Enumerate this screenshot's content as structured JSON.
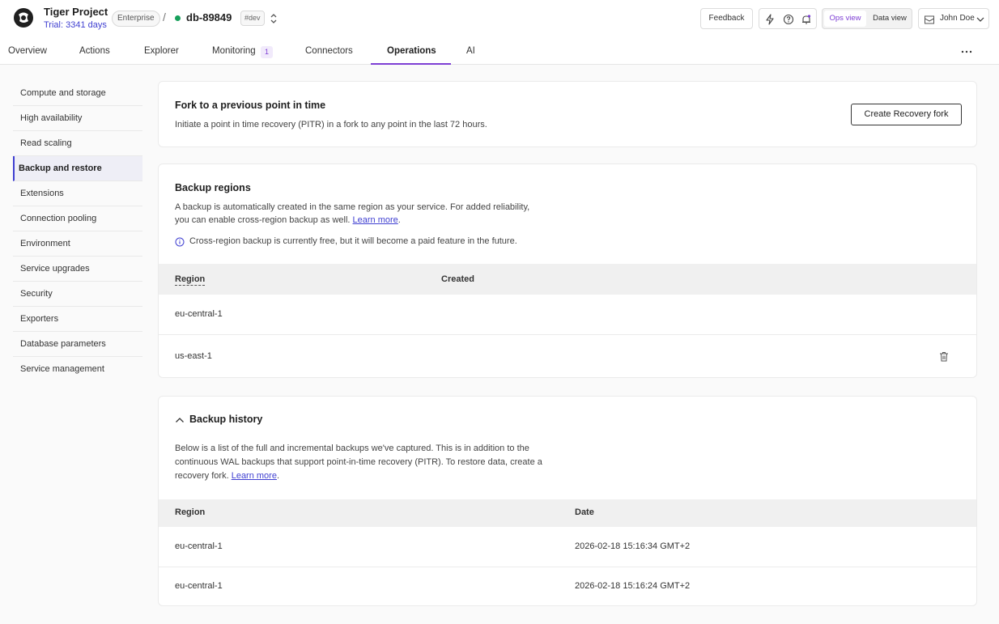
{
  "header": {
    "project_name": "Tiger Project",
    "trial": "Trial: 3341 days",
    "plan_badge": "Enterprise",
    "breadcrumb_sep": "/",
    "service_name": "db-89849",
    "env_badge": "#dev",
    "feedback_label": "Feedback",
    "ops_view_label": "Ops view",
    "data_view_label": "Data view",
    "user_name": "John Doe",
    "status_color": "#17a05b",
    "accent_color": "#7e3fd4",
    "link_color": "#3f3fd1"
  },
  "tabs": [
    {
      "label": "Overview"
    },
    {
      "label": "Actions"
    },
    {
      "label": "Explorer"
    },
    {
      "label": "Monitoring",
      "count": "1"
    },
    {
      "label": "Connectors"
    },
    {
      "label": "Operations",
      "active": true
    },
    {
      "label": "AI"
    }
  ],
  "sidebar": {
    "items": [
      {
        "label": "Compute and storage"
      },
      {
        "label": "High availability"
      },
      {
        "label": "Read scaling"
      },
      {
        "label": "Backup and restore",
        "active": true
      },
      {
        "label": "Extensions"
      },
      {
        "label": "Connection pooling"
      },
      {
        "label": "Environment"
      },
      {
        "label": "Service upgrades"
      },
      {
        "label": "Security"
      },
      {
        "label": "Exporters"
      },
      {
        "label": "Database parameters"
      },
      {
        "label": "Service management"
      }
    ]
  },
  "fork": {
    "title": "Fork to a previous point in time",
    "description": "Initiate a point in time recovery (PITR) in a fork to any point in the last 72 hours.",
    "button_label": "Create Recovery fork"
  },
  "backup_regions": {
    "title": "Backup regions",
    "description_line1": "A backup is automatically created in the same region as your service. For added reliability,",
    "description_line2": "you can enable cross-region backup as well.",
    "learn_more": "Learn more",
    "info_note": "Cross-region backup is currently free, but it will become a paid feature in the future.",
    "columns": [
      "Region",
      "Created"
    ],
    "rows": [
      {
        "region": "eu-central-1",
        "created": ""
      },
      {
        "region": "us-east-1",
        "created": ""
      }
    ]
  },
  "backup_history": {
    "title": "Backup history",
    "description_line1": "Below is a list of the full and incremental backups we've captured. This is in addition to the",
    "description_line2": "continuous WAL backups that support point-in-time recovery (PITR). To restore data, create a",
    "description_line3": "recovery fork.",
    "learn_more": "Learn more",
    "columns": [
      "Region",
      "Date"
    ],
    "rows": [
      {
        "region": "eu-central-1",
        "date": "2026-02-18 15:16:34 GMT+2"
      },
      {
        "region": "eu-central-1",
        "date": "2026-02-18 15:16:24 GMT+2"
      }
    ]
  }
}
